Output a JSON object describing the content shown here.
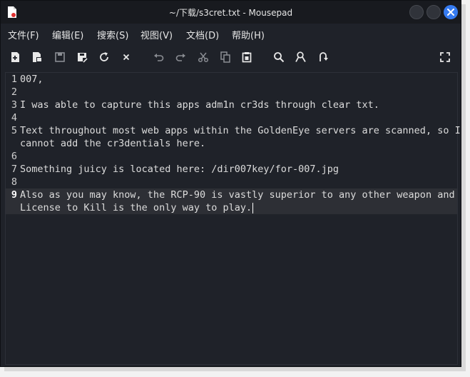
{
  "window": {
    "title": "~/下载/s3cret.txt - Mousepad"
  },
  "menu": [
    {
      "label": "文件(F)"
    },
    {
      "label": "编辑(E)"
    },
    {
      "label": "搜索(S)"
    },
    {
      "label": "视图(V)"
    },
    {
      "label": "文档(D)"
    },
    {
      "label": "帮助(H)"
    }
  ],
  "toolbar": [
    {
      "icon": "new-document-icon"
    },
    {
      "icon": "new-window-icon"
    },
    {
      "icon": "save-icon"
    },
    {
      "icon": "save-as-icon"
    },
    {
      "icon": "reload-icon"
    },
    {
      "icon": "close-icon"
    },
    {
      "icon": "undo-icon"
    },
    {
      "icon": "redo-icon"
    },
    {
      "icon": "cut-icon"
    },
    {
      "icon": "copy-icon"
    },
    {
      "icon": "paste-icon"
    },
    {
      "icon": "find-icon"
    },
    {
      "icon": "find-replace-icon"
    },
    {
      "icon": "go-to-line-icon"
    },
    {
      "icon": "fullscreen-icon"
    }
  ],
  "colors": {
    "accent": "#367bf0",
    "background": "#1f2229",
    "titlebar": "#181a1f"
  },
  "editor": {
    "current_line": 9,
    "lines": [
      {
        "num": "1",
        "text": "007,"
      },
      {
        "num": "2",
        "text": ""
      },
      {
        "num": "3",
        "text": "I was able to capture this apps adm1n cr3ds through clear txt."
      },
      {
        "num": "4",
        "text": ""
      },
      {
        "num": "5",
        "text": "Text throughout most web apps within the GoldenEye servers are scanned, so I"
      },
      {
        "num": "",
        "text": "cannot add the cr3dentials here."
      },
      {
        "num": "6",
        "text": ""
      },
      {
        "num": "7",
        "text": "Something juicy is located here: /dir007key/for-007.jpg"
      },
      {
        "num": "8",
        "text": ""
      },
      {
        "num": "9",
        "text": "Also as you may know, the RCP-90 is vastly superior to any other weapon and"
      },
      {
        "num": "",
        "text": "License to Kill is the only way to play."
      }
    ]
  }
}
